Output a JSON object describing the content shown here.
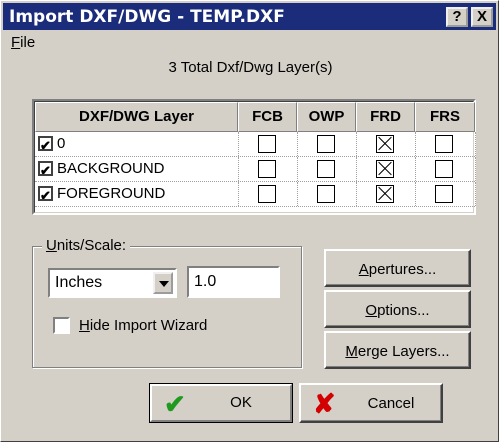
{
  "window": {
    "title": "Import DXF/DWG - TEMP.DXF",
    "help_label": "?",
    "close_label": "X"
  },
  "menu": {
    "file_mnemonic": "F",
    "file_rest": "ile"
  },
  "summary_text": "3 Total Dxf/Dwg Layer(s)",
  "table": {
    "headers": [
      "DXF/DWG Layer",
      "FCB",
      "OWP",
      "FRD",
      "FRS"
    ],
    "rows": [
      {
        "name": "0",
        "enabled": true,
        "FCB": false,
        "OWP": false,
        "FRD": true,
        "FRS": false
      },
      {
        "name": "BACKGROUND",
        "enabled": true,
        "FCB": false,
        "OWP": false,
        "FRD": true,
        "FRS": false
      },
      {
        "name": "FOREGROUND",
        "enabled": true,
        "FCB": false,
        "OWP": false,
        "FRD": true,
        "FRS": false
      }
    ]
  },
  "units_scale": {
    "label_mnemonic": "U",
    "label_rest": "nits/Scale:",
    "unit_selected": "Inches",
    "scale_value": "1.0",
    "hide_wizard_checked": false,
    "hide_wizard_mnemonic": "H",
    "hide_wizard_rest": "ide Import Wizard"
  },
  "buttons": {
    "apertures_mnemonic": "A",
    "apertures_rest": "pertures...",
    "options_mnemonic": "O",
    "options_rest": "ptions...",
    "merge_mnemonic": "M",
    "merge_rest": "erge Layers...",
    "ok_label": "OK",
    "cancel_label": "Cancel"
  },
  "icons": {
    "ok": "checkmark-icon",
    "cancel": "x-icon"
  }
}
